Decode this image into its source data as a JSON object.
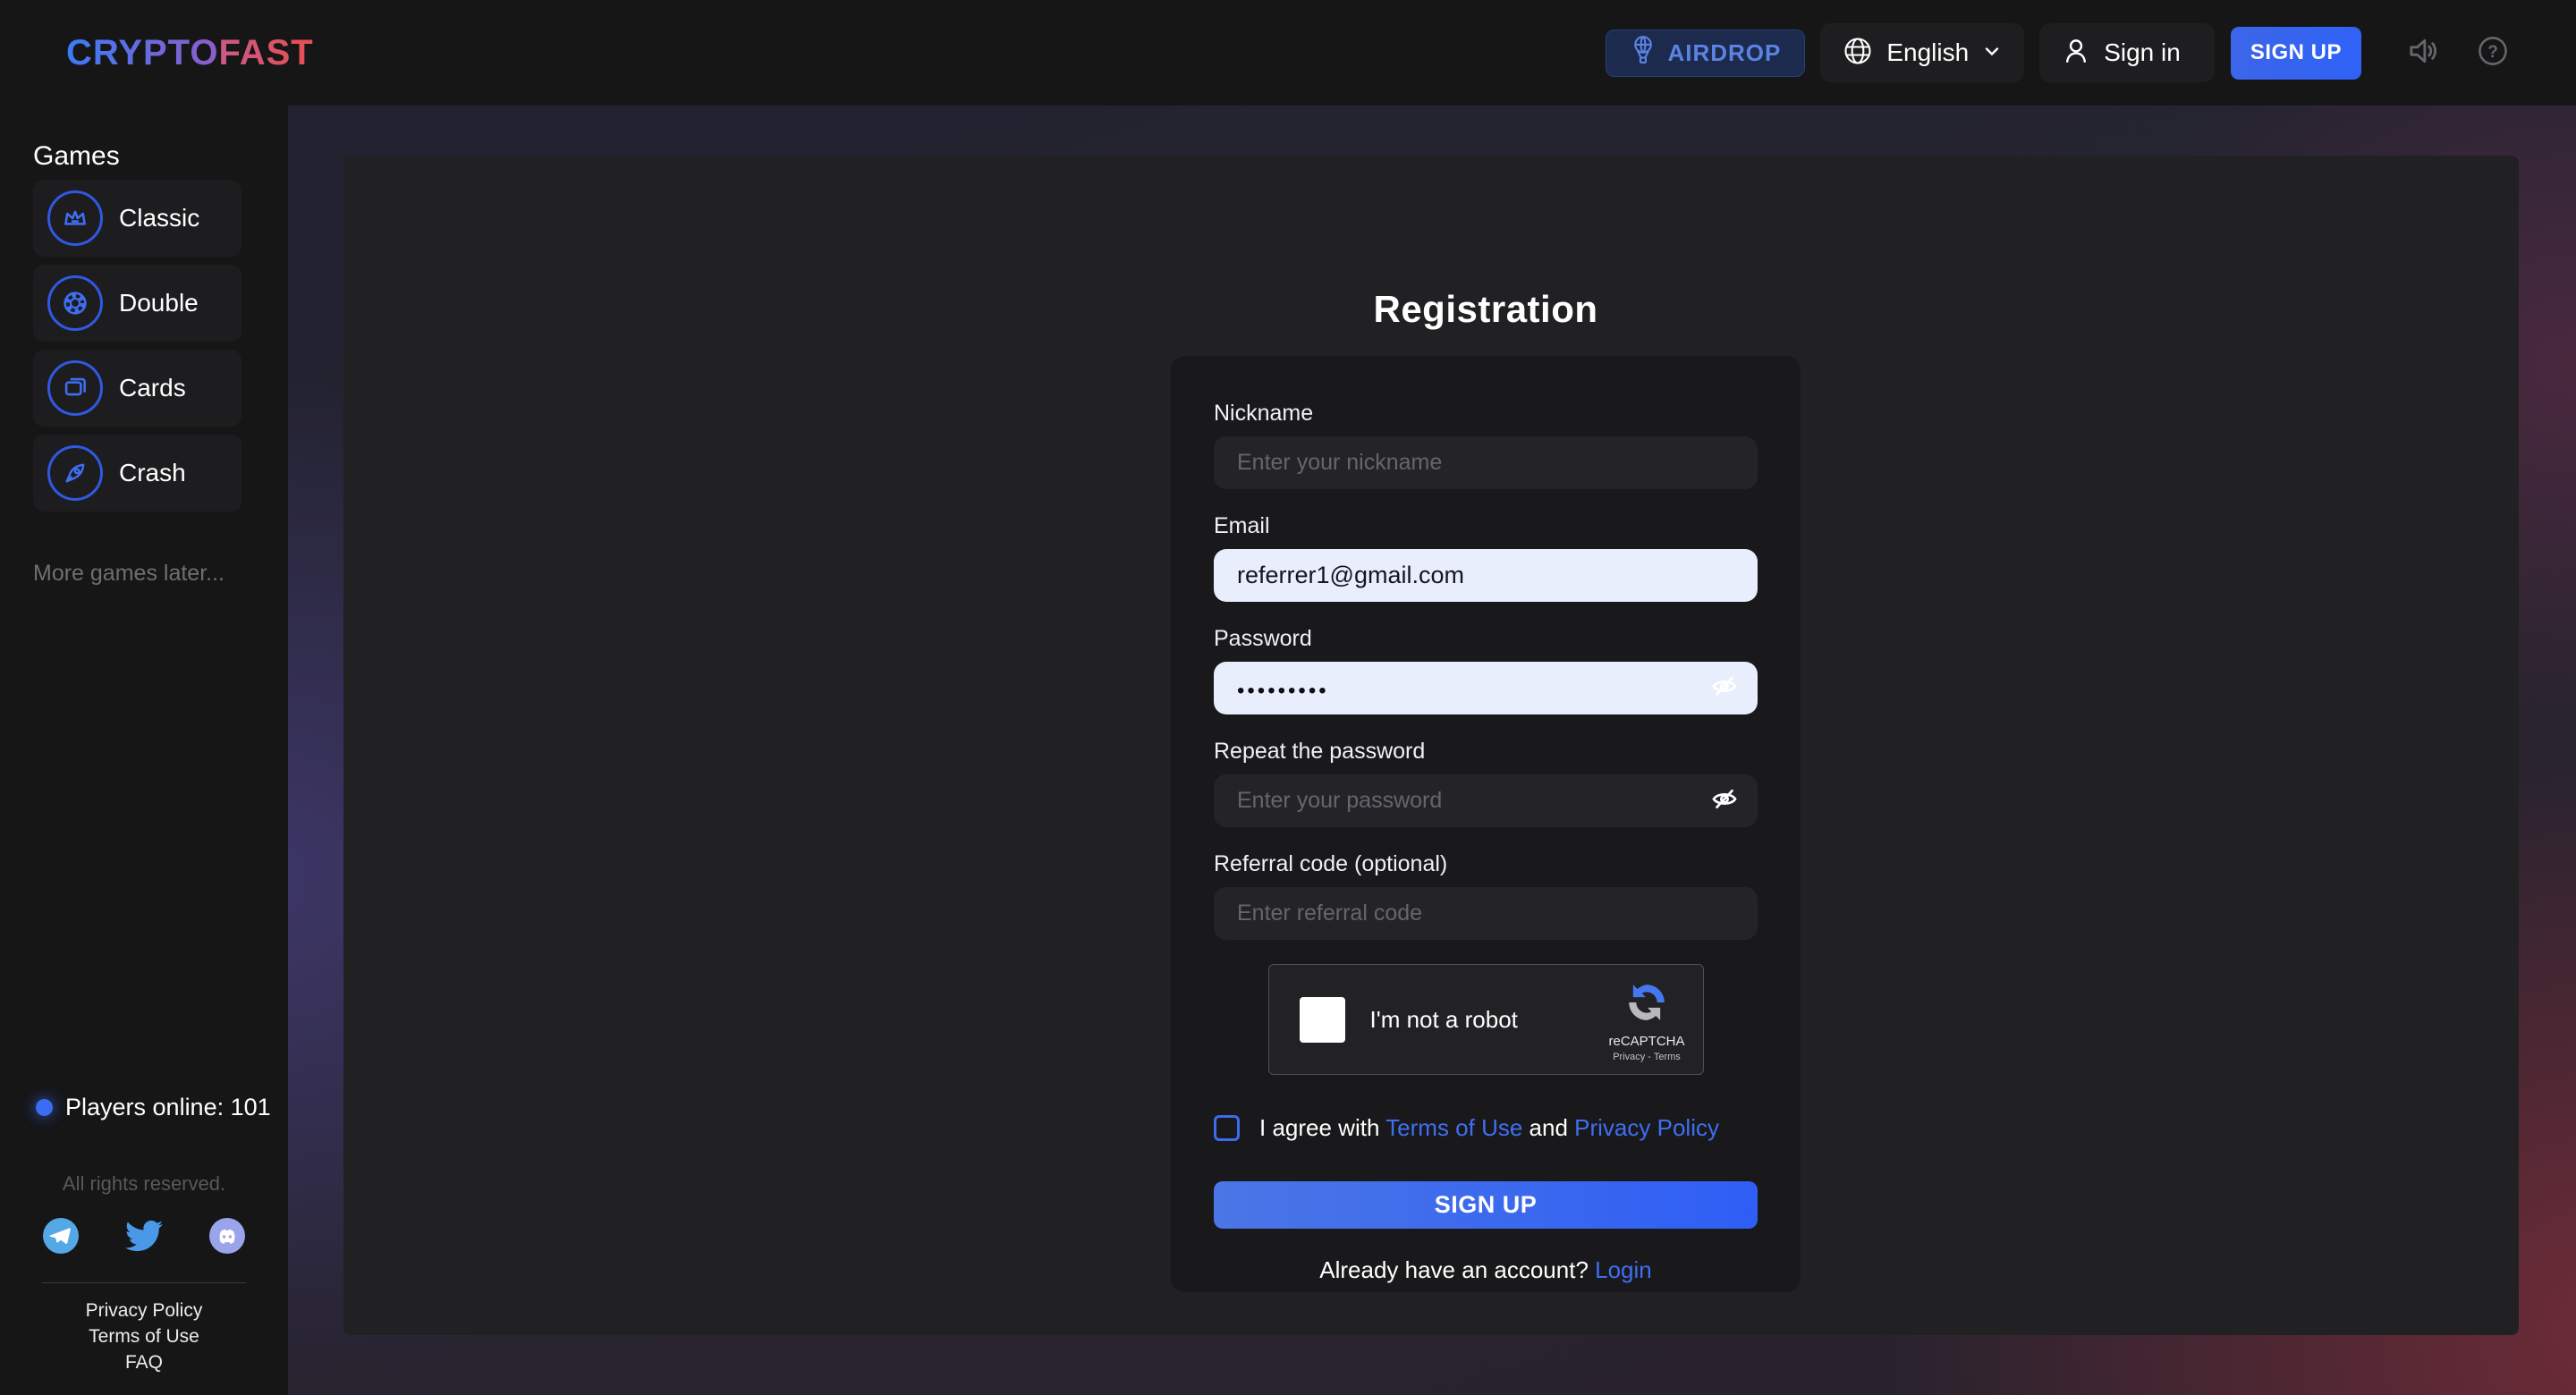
{
  "brand": {
    "part1": "CRYPTO",
    "part2": "FAST"
  },
  "header": {
    "airdrop_label": "AIRDROP",
    "language": "English",
    "sign_in_label": "Sign in",
    "sign_up_label": "SIGN UP"
  },
  "sidebar": {
    "heading": "Games",
    "items": [
      {
        "label": "Classic",
        "icon": "crown-icon"
      },
      {
        "label": "Double",
        "icon": "chip-icon"
      },
      {
        "label": "Cards",
        "icon": "cards-icon"
      },
      {
        "label": "Crash",
        "icon": "rocket-icon"
      }
    ],
    "more_games": "More games later...",
    "players_online": "Players online: 101",
    "rights": "All rights reserved.",
    "social": [
      "telegram-icon",
      "twitter-icon",
      "discord-icon"
    ],
    "links": [
      {
        "label": "Privacy Policy"
      },
      {
        "label": "Terms of Use"
      },
      {
        "label": "FAQ"
      }
    ]
  },
  "form": {
    "title": "Registration",
    "nickname": {
      "label": "Nickname",
      "placeholder": "Enter your nickname"
    },
    "email": {
      "label": "Email",
      "value": "referrer1@gmail.com"
    },
    "password": {
      "label": "Password",
      "value_masked": "•••••••••"
    },
    "repeat": {
      "label": "Repeat the password",
      "placeholder": "Enter your password"
    },
    "referral": {
      "label": "Referral code (optional)",
      "placeholder": "Enter referral code"
    },
    "captcha": {
      "checkbox_label": "I'm not a robot",
      "brand": "reCAPTCHA",
      "privacy_terms": "Privacy - Terms"
    },
    "agree": {
      "prefix": "I agree with ",
      "terms_link": "Terms of Use",
      "middle": " and ",
      "privacy_link": "Privacy Policy"
    },
    "submit_label": "SIGN UP",
    "login_prompt": "Already have an account? ",
    "login_link": "Login"
  },
  "colors": {
    "accent_blue": "#3f6ef2",
    "signup_gradient": [
      "#4b76e6",
      "#2e5ef5"
    ],
    "logo_gradient": [
      "#3b7bf7",
      "#e84e4e"
    ],
    "input_light_bg": "#e9eefc",
    "panel_bg": "#212123",
    "card_bg": "#19191b"
  }
}
